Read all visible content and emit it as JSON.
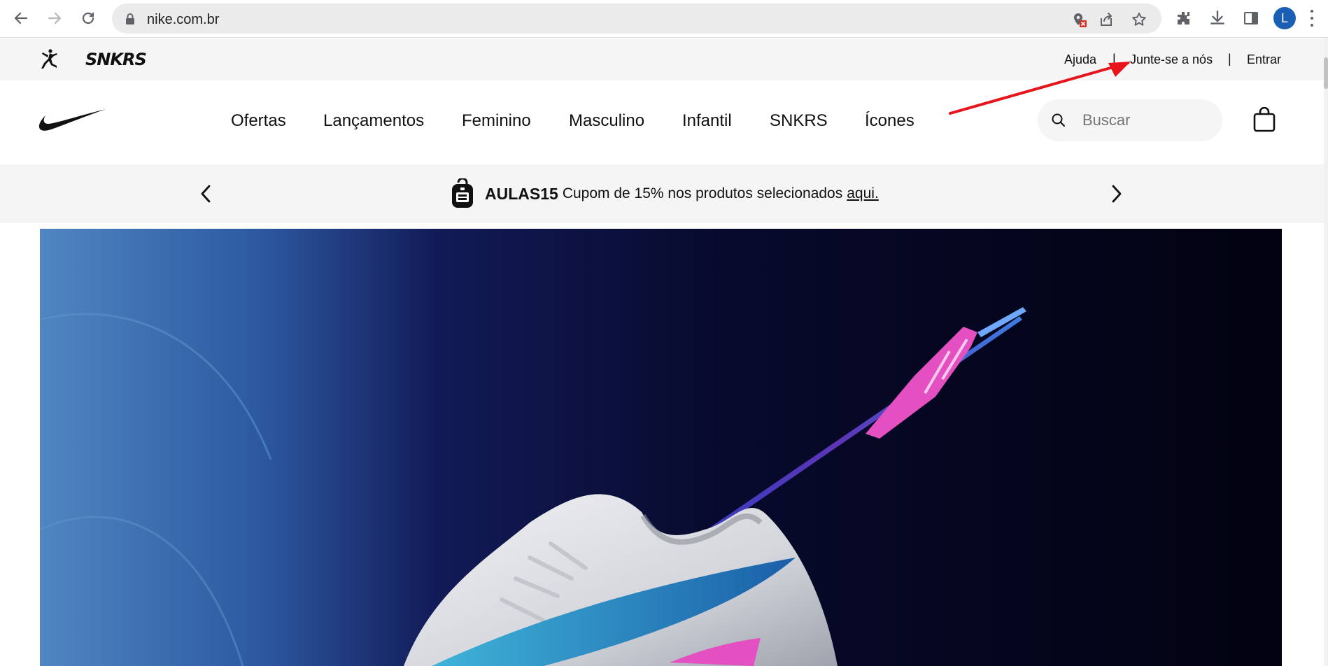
{
  "browser": {
    "url": "nike.com.br",
    "profile_initial": "L",
    "icons": [
      "back-icon",
      "forward-icon",
      "reload-icon",
      "lock-icon",
      "blocked-content-icon",
      "share-icon",
      "bookmark-star-icon",
      "extensions-icon",
      "download-icon",
      "side-panel-icon",
      "profile-avatar",
      "menu-icon"
    ]
  },
  "utility_bar": {
    "brand_logos": [
      "jordan-jumpman-logo",
      "snkrs-logo"
    ],
    "snkrs_text": "SNKRS",
    "links": [
      "Ajuda",
      "Junte-se a nós",
      "Entrar"
    ],
    "separator": "|"
  },
  "main_nav": {
    "logo": "nike-swoosh-logo",
    "items": [
      "Ofertas",
      "Lançamentos",
      "Feminino",
      "Masculino",
      "Infantil",
      "SNKRS",
      "Ícones"
    ],
    "search_placeholder": "Buscar",
    "bag_icon": "shopping-bag-icon"
  },
  "promo": {
    "code": "AULAS15",
    "message": "Cupom de 15% nos produtos selecionados",
    "link": "aqui.",
    "icon": "backpack-icon"
  },
  "hero": {
    "description_icon": "soccer-cleat-with-arrow-image"
  },
  "annotation": {
    "color": "#e8141c",
    "points_to": "Junte-se a nós"
  },
  "colors": {
    "hero_light_blue": "#4f86c1",
    "hero_dark_navy": "#070a2c",
    "accent_pink": "#e44fc1"
  }
}
